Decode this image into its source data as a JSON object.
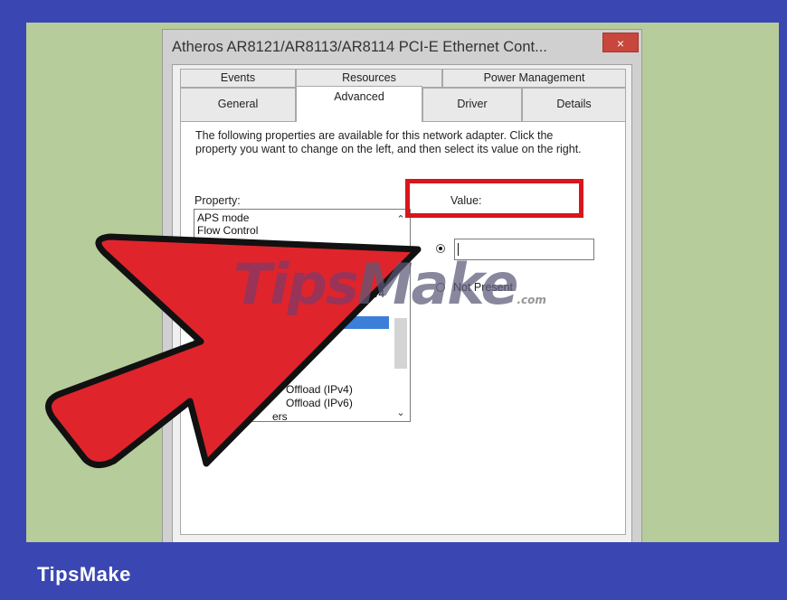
{
  "window": {
    "title": "Atheros AR8121/AR8113/AR8114 PCI-E Ethernet Cont...",
    "close_label": "×"
  },
  "tabs": {
    "row1": [
      "Events",
      "Resources",
      "Power Management"
    ],
    "row2": [
      "General",
      "Advanced",
      "Driver",
      "Details"
    ],
    "active": "Advanced"
  },
  "panel": {
    "description": "The following properties are available for this network adapter. Click the property you want to change on the left, and then select its value on the right.",
    "property_label": "Property:",
    "value_label": "Value:",
    "properties": [
      "APS mode",
      "Flow Control",
      "IPv4",
      "Offload (IPv4)",
      "Offload (IPv6)",
      "ers"
    ],
    "value_input": "",
    "not_present_label": "Not Present",
    "value_radio_selected": true
  },
  "watermark": {
    "part1": "Tips",
    "part2": "Make",
    "part3": ".com"
  },
  "brand": {
    "label": "TipsMake"
  },
  "colors": {
    "border_blue": "#3a47b2",
    "background_green": "#b6cc9a",
    "highlight_red": "#d8161b",
    "arrow_red": "#e0242c",
    "close_red": "#c9463c"
  },
  "icons": {
    "close": "close-icon",
    "scroll_up": "chevron-up-icon",
    "scroll_down": "chevron-down-icon",
    "arrow": "red-pointer-arrow-icon"
  }
}
